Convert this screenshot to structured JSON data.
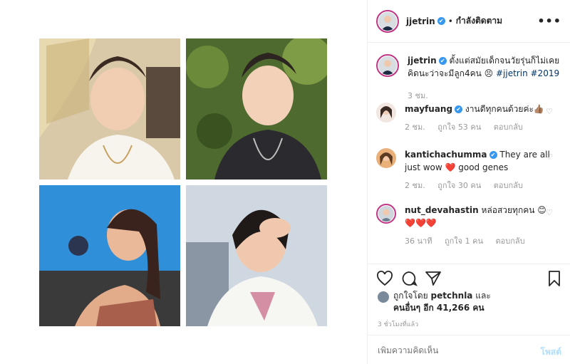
{
  "header": {
    "username": "jjetrin",
    "verified_mark": "✔",
    "separator": "•",
    "follow_status": "กำลังติดตาม",
    "more": "•••"
  },
  "caption": {
    "username": "jjetrin",
    "text": "ตั้งแต่สมัยเด็กจนวัยรุ่นก็ไม่เคยคิดนะว่าจะมีลูก4คน",
    "emoji": "😣",
    "hashtags": "#jjetrin #2019",
    "time": "3 ชม."
  },
  "comments": [
    {
      "username": "mayfuang",
      "verified": true,
      "text": "งานดีทุกคนด้วยค่ะ👍🏽",
      "time": "2 ชม.",
      "likes": "ถูกใจ 53 คน",
      "reply": "ตอบกลับ"
    },
    {
      "username": "kantichachumma",
      "verified": true,
      "text": "They are all just wow ❤️ good genes",
      "time": "2 ชม.",
      "likes": "ถูกใจ 30 คน",
      "reply": "ตอบกลับ"
    },
    {
      "username": "nut_devahastin",
      "verified": false,
      "text": "หล่อสวยทุกคน 😊",
      "hearts": "❤️❤️❤️",
      "time": "36 นาที",
      "likes": "ถูกใจ 1 คน",
      "reply": "ตอบกลับ"
    }
  ],
  "likes_line": {
    "prefix": "ถูกใจโดย",
    "liker": "petchnla",
    "and": "และ",
    "others": "คนอื่นๆ อีก 41,266 คน"
  },
  "timestamp": "3 ชั่วโมงที่แล้ว",
  "add_comment": {
    "placeholder": "เพิ่มความคิดเห็น",
    "post_label": "โพสต์"
  },
  "icons": {
    "like": "heart-icon",
    "comment": "comment-icon",
    "share": "share-icon",
    "save": "bookmark-icon",
    "comment_like": "heart-outline-icon"
  },
  "colors": {
    "verified": "#3897f0",
    "hashtag": "#003569",
    "muted": "#999999",
    "post_disabled": "#b2dffc",
    "story_ring": "#c13584"
  }
}
